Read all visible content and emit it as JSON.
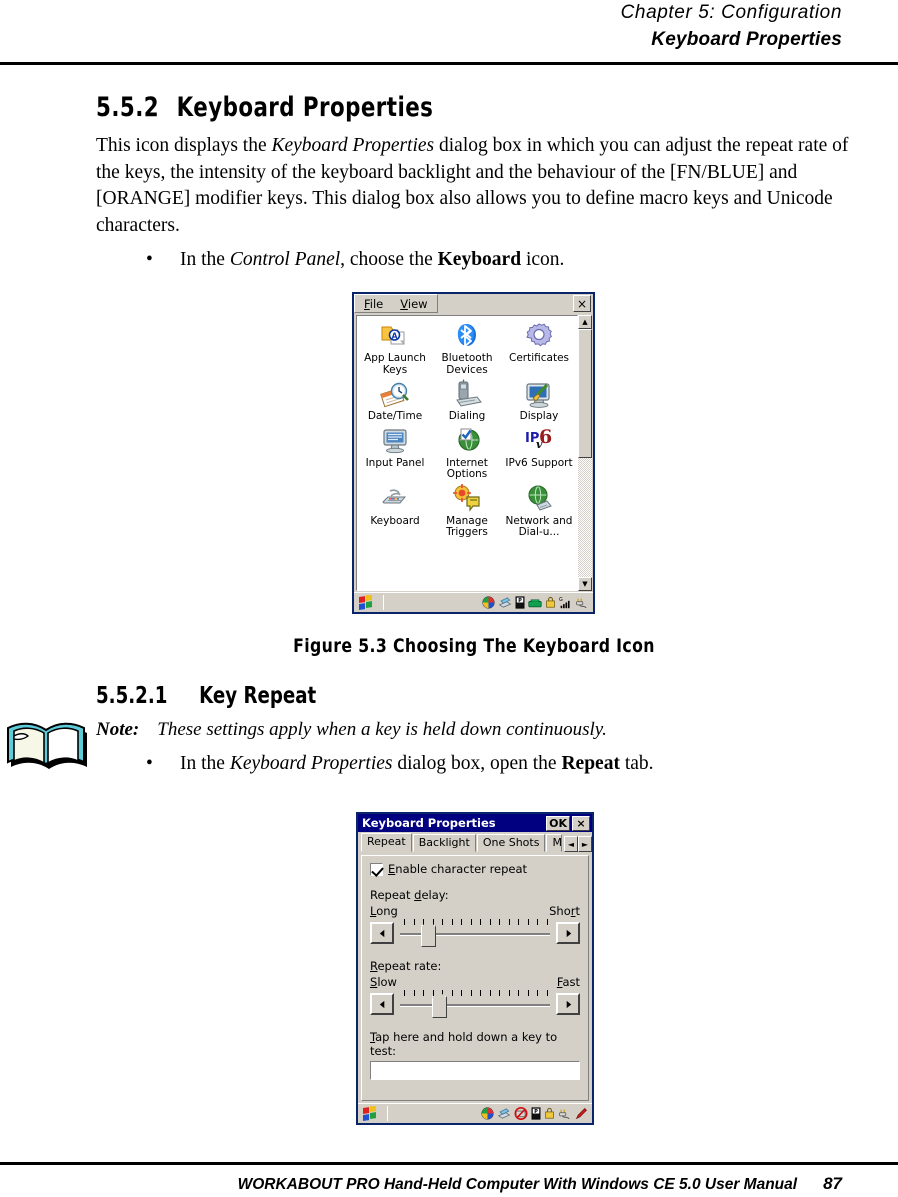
{
  "running_head": {
    "chapter": "Chapter 5: Configuration",
    "section": "Keyboard Properties"
  },
  "section": {
    "number": "5.5.2",
    "title": "Keyboard Properties",
    "paragraph_1a": "This icon displays the ",
    "paragraph_1b": "Keyboard Properties",
    "paragraph_1c": " dialog box in which you can adjust the repeat rate of the keys, the intensity of the keyboard backlight and the behaviour of the [FN/BLUE] and [ORANGE] modifier keys. This dialog box also allows you to define macro keys and Unicode characters.",
    "bullet_1a": "In the ",
    "bullet_1b": "Control Panel",
    "bullet_1c": ", choose the ",
    "bullet_1d": "Keyboard",
    "bullet_1e": " icon."
  },
  "figure": {
    "caption": "Figure 5.3 Choosing The Keyboard Icon"
  },
  "subsection": {
    "number": "5.5.2.1",
    "title": "Key Repeat",
    "note_label": "Note:",
    "note_text": "These settings apply when a key is held down continuously.",
    "bullet_1a": "In the ",
    "bullet_1b": "Keyboard Properties",
    "bullet_1c": " dialog box, open the ",
    "bullet_1d": "Repeat",
    "bullet_1e": " tab."
  },
  "control_panel": {
    "menu": [
      {
        "label": "File",
        "hotkey": "F"
      },
      {
        "label": "View",
        "hotkey": "V"
      }
    ],
    "close_label": "×",
    "icons": [
      {
        "name": "app-launch-keys",
        "label": "App Launch Keys",
        "icon": "folder-a-icon"
      },
      {
        "name": "bluetooth-devices",
        "label": "Bluetooth Devices",
        "icon": "bluetooth-icon"
      },
      {
        "name": "certificates",
        "label": "Certificates",
        "icon": "gear-icon"
      },
      {
        "name": "date-time",
        "label": "Date/Time",
        "icon": "clock-calendar-icon"
      },
      {
        "name": "dialing",
        "label": "Dialing",
        "icon": "phone-modem-icon"
      },
      {
        "name": "display",
        "label": "Display",
        "icon": "monitor-brush-icon"
      },
      {
        "name": "input-panel",
        "label": "Input Panel",
        "icon": "onscreen-keyboard-icon"
      },
      {
        "name": "internet-options",
        "label": "Internet Options",
        "icon": "globe-check-icon"
      },
      {
        "name": "ipv6-support",
        "label": "IPv6 Support",
        "icon": "ipv6-icon"
      },
      {
        "name": "keyboard",
        "label": "Keyboard",
        "icon": "keyboard-icon"
      },
      {
        "name": "manage-triggers",
        "label": "Manage Triggers",
        "icon": "trigger-target-icon"
      },
      {
        "name": "network-dialup",
        "label": "Network and Dial-u...",
        "icon": "globe-network-icon"
      }
    ],
    "scrollbar": {
      "up": "▲",
      "down": "▼"
    },
    "tray_icons": [
      "volume-icon",
      "activesync-icon",
      "battery-icon",
      "phone-icon",
      "lock-icon",
      "signal-icon",
      "power-plug-icon"
    ],
    "highlighted_icon": "keyboard"
  },
  "keyboard_properties": {
    "title": "Keyboard Properties",
    "ok_label": "OK",
    "close_label": "×",
    "tabs": [
      {
        "label": "Repeat",
        "selected": true
      },
      {
        "label": "Backlight",
        "selected": false
      },
      {
        "label": "One Shots",
        "selected": false
      },
      {
        "label": "Ma",
        "selected": false
      }
    ],
    "tab_scroll_left": "◄",
    "tab_scroll_right": "►",
    "enable_repeat": {
      "label": "Enable character repeat",
      "hotkey": "E",
      "checked": true
    },
    "repeat_delay": {
      "group_label": "Repeat delay:",
      "hotkey": "d",
      "left_label": "Long",
      "left_hotkey": "L",
      "right_label": "Short",
      "right_hotkey": "r",
      "left_arrow": "◄",
      "right_arrow": "►",
      "ticks": 16,
      "value_percent": 14
    },
    "repeat_rate": {
      "group_label": "Repeat rate:",
      "hotkey": "R",
      "left_label": "Slow",
      "left_hotkey": "S",
      "right_label": "Fast",
      "right_hotkey": "F",
      "left_arrow": "◄",
      "right_arrow": "►",
      "ticks": 16,
      "value_percent": 21
    },
    "test_field": {
      "label": "Tap here and hold down a key to test:",
      "hotkey": "T",
      "value": ""
    },
    "tray_icons": [
      "volume-icon",
      "activesync-icon",
      "no-connection-icon",
      "battery-icon",
      "lock-icon",
      "power-plug-icon",
      "stylus-pen-icon"
    ]
  },
  "footer": {
    "text": "WORKABOUT PRO Hand-Held Computer With Windows CE 5.0 User Manual",
    "page": "87"
  },
  "colors": {
    "title_bar": "#000080",
    "window_face": "#d4d0c8",
    "window_border": "#0a246a",
    "bluetooth_blue": "#1a6fe0",
    "ipv6_blue": "#1d1da8",
    "ipv6_red": "#9b1b1b"
  }
}
